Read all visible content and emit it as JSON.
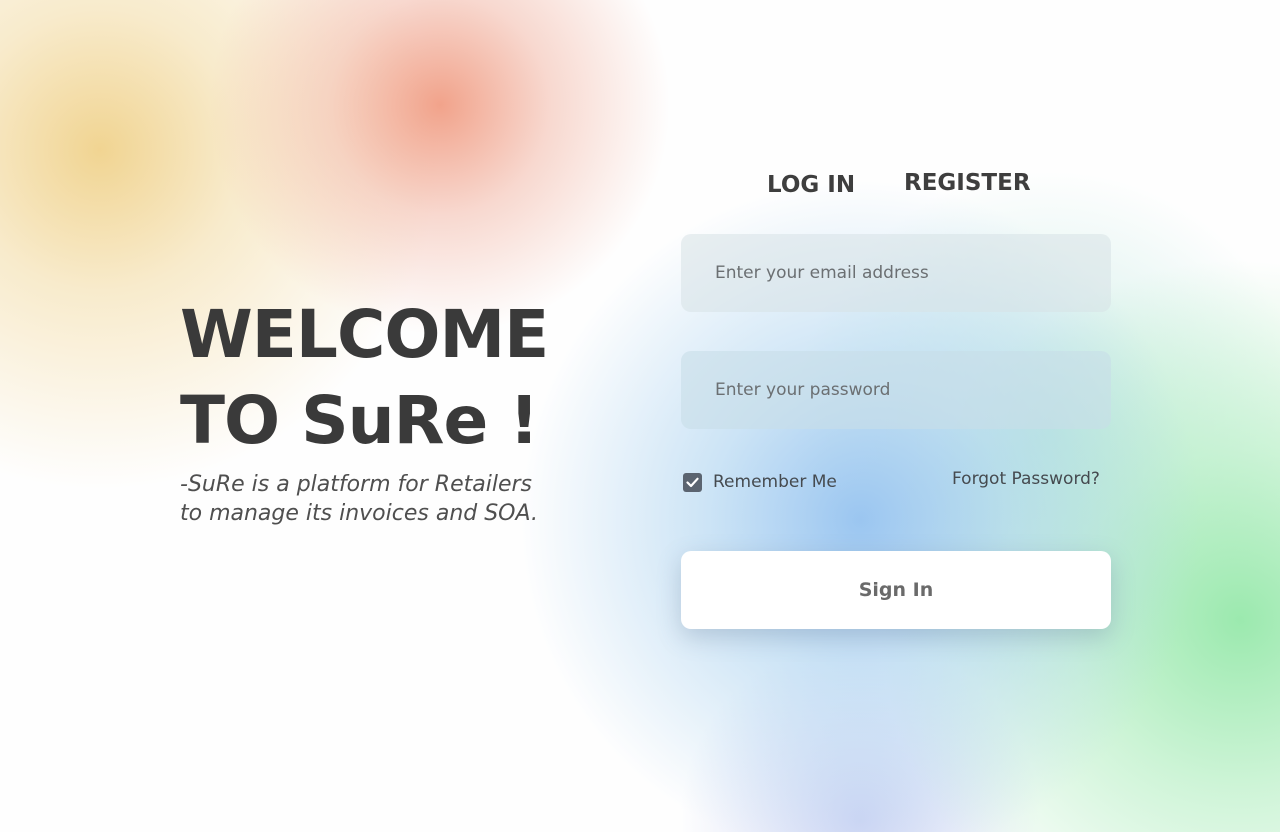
{
  "welcome": {
    "line1": "WELCOME",
    "line2": "TO SuRe !",
    "tagline_line1": "-SuRe is a platform for Retailers",
    "tagline_line2": "to manage its invoices and SOA."
  },
  "tabs": {
    "login": "LOG IN",
    "register": "REGISTER"
  },
  "form": {
    "email_placeholder": "Enter your email address",
    "email_value": "",
    "password_placeholder": "Enter your password",
    "password_value": "",
    "remember_label": "Remember Me",
    "remember_checked": true,
    "forgot_label": "Forgot Password?",
    "signin_label": "Sign In"
  },
  "icons": {
    "checkbox": "check-icon"
  },
  "colors": {
    "heading": "#3a3a3a",
    "checkbox": "#5b6470",
    "button_bg": "#ffffff",
    "button_text": "#6a6a6a"
  }
}
